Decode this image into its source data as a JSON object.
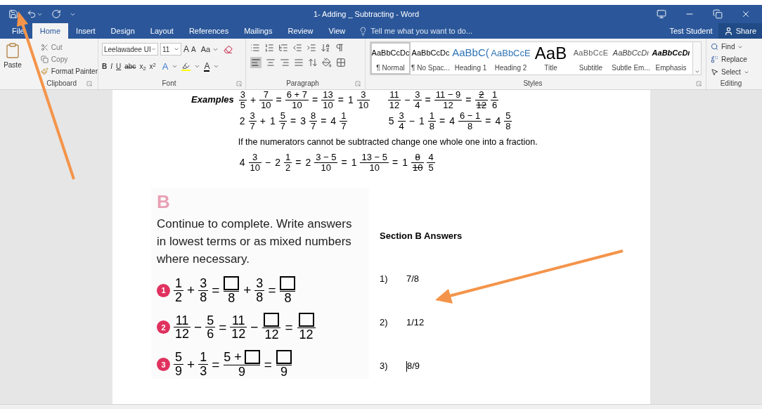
{
  "window": {
    "title": "1- Adding _ Subtracting - Word"
  },
  "tabs": [
    {
      "label": "File",
      "selected": false
    },
    {
      "label": "Home",
      "selected": true
    },
    {
      "label": "Insert",
      "selected": false
    },
    {
      "label": "Design",
      "selected": false
    },
    {
      "label": "Layout",
      "selected": false
    },
    {
      "label": "References",
      "selected": false
    },
    {
      "label": "Mailings",
      "selected": false
    },
    {
      "label": "Review",
      "selected": false
    },
    {
      "label": "View",
      "selected": false
    }
  ],
  "tell_me": {
    "placeholder": "Tell me what you want to do..."
  },
  "user": "Test Student",
  "share": "Share",
  "clipboard": {
    "paste": "Paste",
    "cut": "Cut",
    "copy": "Copy",
    "format_painter": "Format Painter",
    "label": "Clipboard"
  },
  "font": {
    "name": "Leelawadee UI",
    "size": "11",
    "case_button": "Aa",
    "grow": "A",
    "shrink": "A",
    "format_buttons": [
      "B",
      "I",
      "U",
      "abc",
      "x$_{2}$",
      "x$^{2}$"
    ],
    "text_effects": "A",
    "font_color": "A",
    "label": "Font"
  },
  "paragraph": {
    "label": "Paragraph"
  },
  "styles": {
    "label": "Styles",
    "items": [
      {
        "kind": "normal",
        "preview": "AaBbCcDc",
        "name": "¶ Normal",
        "selected": true
      },
      {
        "kind": "nospacing",
        "preview": "AaBbCcDc",
        "name": "¶ No Spac...",
        "selected": false
      },
      {
        "kind": "heading1",
        "preview": "AaBbC(",
        "name": "Heading 1",
        "selected": false
      },
      {
        "kind": "heading2",
        "preview": "AaBbCcE",
        "name": "Heading 2",
        "selected": false
      },
      {
        "kind": "title",
        "preview": "AaB",
        "name": "Title",
        "selected": false
      },
      {
        "kind": "subtitle",
        "preview": "AaBbCcE",
        "name": "Subtitle",
        "selected": false
      },
      {
        "kind": "subtle",
        "preview": "AaBbCcDı",
        "name": "Subtle Em...",
        "selected": false
      },
      {
        "kind": "emphasis",
        "preview": "AaBbCcDı",
        "name": "Emphasis",
        "selected": false
      }
    ]
  },
  "editing": {
    "label": "Editing",
    "find": "Find",
    "replace": "Replace",
    "select": "Select"
  },
  "examples": {
    "label": "Examples",
    "rows": [
      {
        "left": [
          {
            "kind": "frac",
            "num": "3",
            "den": "5",
            "struck": false
          },
          {
            "kind": "op",
            "text": "+"
          },
          {
            "kind": "frac",
            "num": "7",
            "den": "10",
            "struck": false
          },
          {
            "kind": "op",
            "text": "="
          },
          {
            "kind": "frac",
            "num": "6 + 7",
            "den": "10",
            "struck": false
          },
          {
            "kind": "op",
            "text": "="
          },
          {
            "kind": "frac",
            "num": "13",
            "den": "10",
            "struck": false
          },
          {
            "kind": "op",
            "text": "="
          },
          {
            "kind": "num",
            "text": "1"
          },
          {
            "kind": "frac",
            "num": "3",
            "den": "10",
            "struck": false
          }
        ],
        "right": [
          {
            "kind": "frac",
            "num": "11",
            "den": "12",
            "struck": false
          },
          {
            "kind": "op",
            "text": "−"
          },
          {
            "kind": "frac",
            "num": "3",
            "den": "4",
            "struck": false
          },
          {
            "kind": "op",
            "text": "="
          },
          {
            "kind": "frac",
            "num": "11 − 9",
            "den": "12",
            "struck": false
          },
          {
            "kind": "op",
            "text": "="
          },
          {
            "kind": "frac",
            "num": "2",
            "den": "12",
            "struck": true
          },
          {
            "kind": "frac",
            "num": "1",
            "den": "6",
            "struck": false
          }
        ]
      },
      {
        "left": [
          {
            "kind": "num",
            "text": "2"
          },
          {
            "kind": "frac",
            "num": "3",
            "den": "7",
            "struck": false
          },
          {
            "kind": "op",
            "text": "+"
          },
          {
            "kind": "num",
            "text": "1"
          },
          {
            "kind": "frac",
            "num": "5",
            "den": "7",
            "struck": false
          },
          {
            "kind": "op",
            "text": "="
          },
          {
            "kind": "num",
            "text": "3"
          },
          {
            "kind": "frac",
            "num": "8",
            "den": "7",
            "struck": false
          },
          {
            "kind": "op",
            "text": "="
          },
          {
            "kind": "num",
            "text": "4"
          },
          {
            "kind": "frac",
            "num": "1",
            "den": "7",
            "struck": false
          }
        ],
        "right": [
          {
            "kind": "num",
            "text": "5"
          },
          {
            "kind": "frac",
            "num": "3",
            "den": "4",
            "struck": false
          },
          {
            "kind": "op",
            "text": "−"
          },
          {
            "kind": "num",
            "text": "1"
          },
          {
            "kind": "frac",
            "num": "1",
            "den": "8",
            "struck": false
          },
          {
            "kind": "op",
            "text": "="
          },
          {
            "kind": "num",
            "text": "4"
          },
          {
            "kind": "frac",
            "num": "6 − 1",
            "den": "8",
            "struck": false
          },
          {
            "kind": "op",
            "text": "="
          },
          {
            "kind": "num",
            "text": "4"
          },
          {
            "kind": "frac",
            "num": "5",
            "den": "8",
            "struck": false
          }
        ]
      }
    ],
    "note": "If the numerators cannot be subtracted change one whole one into a fraction.",
    "last": [
      {
        "kind": "num",
        "text": "4"
      },
      {
        "kind": "frac",
        "num": "3",
        "den": "10",
        "struck": false
      },
      {
        "kind": "op",
        "text": "−"
      },
      {
        "kind": "num",
        "text": "2"
      },
      {
        "kind": "frac",
        "num": "1",
        "den": "2",
        "struck": false
      },
      {
        "kind": "op",
        "text": "="
      },
      {
        "kind": "num",
        "text": "2"
      },
      {
        "kind": "frac",
        "num": "3 − 5",
        "den": "10",
        "struck": false
      },
      {
        "kind": "op",
        "text": "="
      },
      {
        "kind": "num",
        "text": "1"
      },
      {
        "kind": "frac",
        "num": "13 − 5",
        "den": "10",
        "struck": false
      },
      {
        "kind": "op",
        "text": "="
      },
      {
        "kind": "num",
        "text": "1"
      },
      {
        "kind": "frac",
        "num": "8",
        "den": "10",
        "struck": true
      },
      {
        "kind": "frac",
        "num": "4",
        "den": "5",
        "struck": false
      }
    ]
  },
  "worksheet": {
    "letter": "B",
    "instructions": "Continue to complete. Write answers in lowest terms or as mixed numbers where necessary.",
    "problems": [
      {
        "number": "1",
        "tokens": [
          {
            "kind": "frac",
            "num": "1",
            "den": "2",
            "struck": false
          },
          {
            "kind": "op",
            "text": "+"
          },
          {
            "kind": "frac",
            "num": "3",
            "den": "8",
            "struck": false
          },
          {
            "kind": "op",
            "text": "="
          },
          {
            "kind": "box-frac",
            "den": "8"
          },
          {
            "kind": "op",
            "text": "+"
          },
          {
            "kind": "frac",
            "num": "3",
            "den": "8",
            "struck": false
          },
          {
            "kind": "op",
            "text": "="
          },
          {
            "kind": "box-frac",
            "den": "8"
          }
        ]
      },
      {
        "number": "2",
        "tokens": [
          {
            "kind": "frac",
            "num": "11",
            "den": "12",
            "struck": false
          },
          {
            "kind": "op",
            "text": "−"
          },
          {
            "kind": "frac",
            "num": "5",
            "den": "6",
            "struck": false
          },
          {
            "kind": "op",
            "text": "="
          },
          {
            "kind": "frac",
            "num": "11",
            "den": "12",
            "struck": false
          },
          {
            "kind": "op",
            "text": "−"
          },
          {
            "kind": "box-frac",
            "den": "12"
          },
          {
            "kind": "op",
            "text": "="
          },
          {
            "kind": "box-frac",
            "den": "12"
          }
        ]
      },
      {
        "number": "3",
        "tokens": [
          {
            "kind": "frac",
            "num": "5",
            "den": "9",
            "struck": false
          },
          {
            "kind": "op",
            "text": "+"
          },
          {
            "kind": "frac",
            "num": "1",
            "den": "3",
            "struck": false
          },
          {
            "kind": "op",
            "text": "="
          },
          {
            "kind": "sum-box-frac",
            "num": "5 +",
            "den": "9"
          },
          {
            "kind": "op",
            "text": "="
          },
          {
            "kind": "box-frac",
            "den": "9"
          }
        ]
      }
    ]
  },
  "answers": {
    "heading": "Section B Answers",
    "items": [
      {
        "number": "1)",
        "value": "7/8",
        "cursor": false
      },
      {
        "number": "2)",
        "value": "1/12",
        "cursor": false
      },
      {
        "number": "3)",
        "value": "8/9",
        "cursor": true
      }
    ]
  }
}
